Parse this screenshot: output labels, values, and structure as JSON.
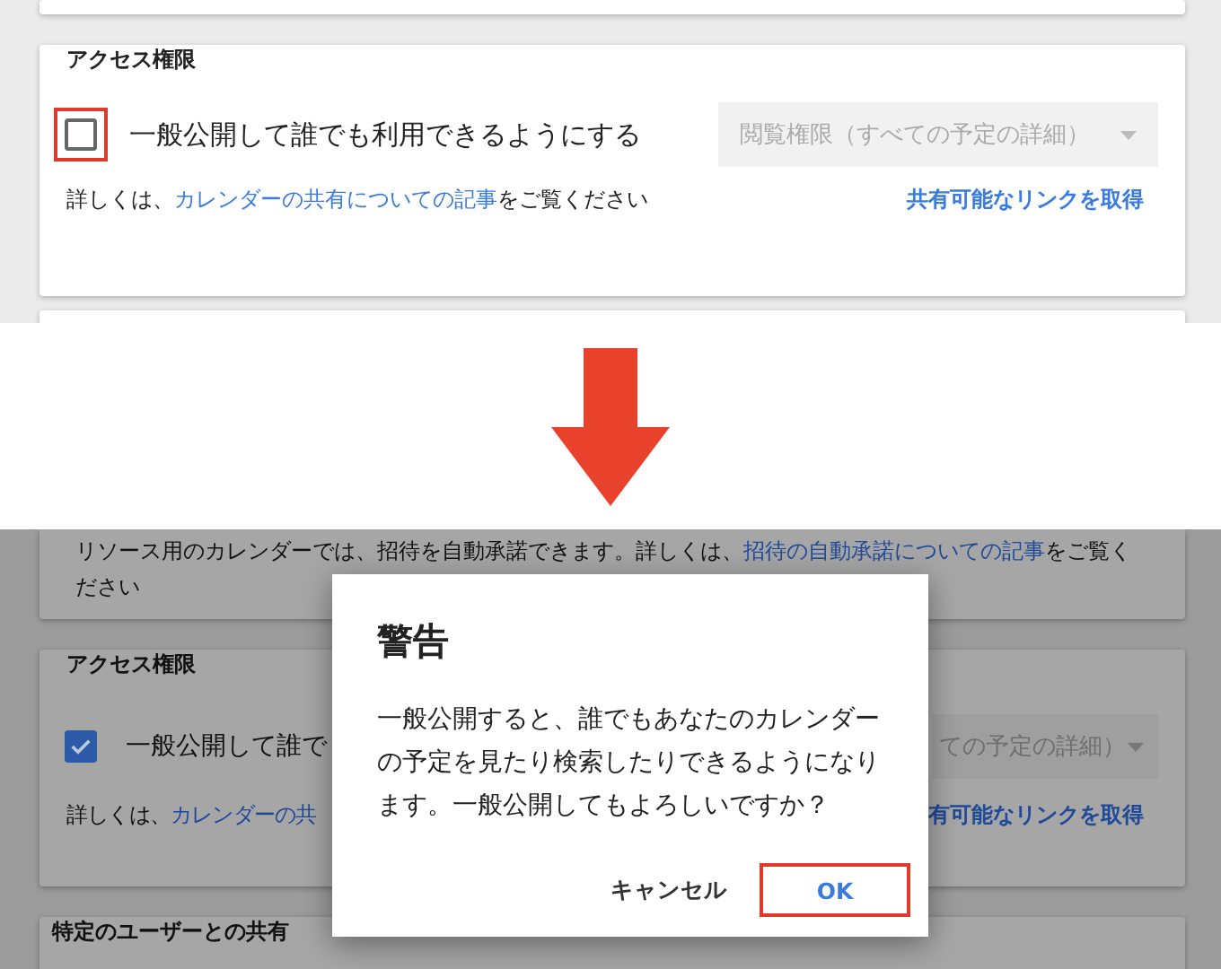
{
  "before": {
    "permissions_card": {
      "title": "アクセス権限",
      "public_checkbox": {
        "label": "一般公開して誰でも利用できるようにする",
        "checked": false,
        "highlighted": true
      },
      "permission_dropdown": {
        "value": "閲覧権限（すべての予定の詳細）",
        "disabled": true
      },
      "help_text": {
        "prefix": "詳しくは、",
        "link": "カレンダーの共有についての記事",
        "suffix": "をご覧ください"
      },
      "share_link": "共有可能なリンクを取得"
    }
  },
  "after": {
    "resource_note": {
      "prefix": "リソース用のカレンダーでは、招待を自動承諾できます。詳しくは、",
      "link": "招待の自動承諾についての記事",
      "suffix": "をご覧ください"
    },
    "permissions_card": {
      "title": "アクセス権限",
      "public_checkbox": {
        "label": "一般公開して誰で",
        "checked": true,
        "highlighted": false
      },
      "permission_dropdown": {
        "value": "ての予定の詳細）",
        "disabled": true
      },
      "help_text": {
        "prefix": "詳しくは、",
        "link": "カレンダーの共"
      },
      "share_link": "有可能なリンクを取得"
    },
    "users_card": {
      "title": "特定のユーザーとの共有"
    },
    "dialog": {
      "title": "警告",
      "message": "一般公開すると、誰でもあなたのカレンダーの予定を見たり検索したりできるようになります。一般公開してもよろしいですか？",
      "buttons": [
        {
          "label": "キャンセル",
          "kind": "text",
          "highlighted": false
        },
        {
          "label": "OK",
          "kind": "primary",
          "highlighted": true
        }
      ]
    }
  }
}
